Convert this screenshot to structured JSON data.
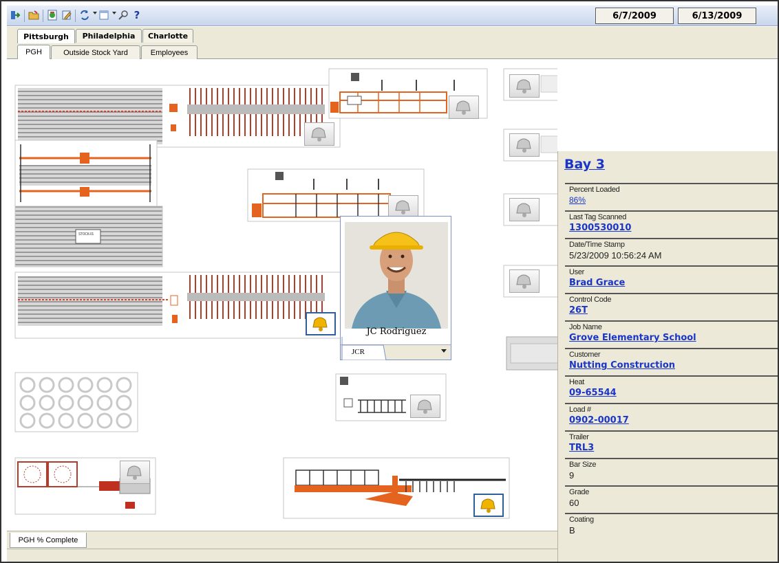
{
  "toolbar": {
    "icons": [
      "exit-icon",
      "open-folder-icon",
      "report-icon",
      "edit-icon",
      "refresh-icon",
      "view-icon",
      "search-icon",
      "help-icon"
    ],
    "help_glyph": "?",
    "start_date": "6/7/2009",
    "end_date": "6/13/2009"
  },
  "location_tabs": [
    "Pittsburgh",
    "Philadelphia",
    "Charlotte"
  ],
  "area_tabs": [
    "PGH",
    "Outside Stock Yard",
    "Employees"
  ],
  "canvas": {
    "stock_label": "STOCK-01"
  },
  "employee": {
    "name": "JC Rodriguez",
    "initials": "JCR"
  },
  "detail": {
    "title": "Bay 3",
    "fields": [
      {
        "label": "Percent Loaded",
        "value": "86%"
      },
      {
        "label": "Last Tag Scanned",
        "value": "1300530010"
      },
      {
        "label": "Date/Time Stamp",
        "value": "5/23/2009 10:56:24 AM"
      },
      {
        "label": "User",
        "value": "Brad Grace"
      },
      {
        "label": "Control Code",
        "value": "26T"
      },
      {
        "label": "Job Name",
        "value": "Grove Elementary School"
      },
      {
        "label": "Customer",
        "value": "Nutting Construction"
      },
      {
        "label": "Heat",
        "value": "09-65544"
      },
      {
        "label": "Load #",
        "value": "0902-00017"
      },
      {
        "label": "Trailer",
        "value": "TRL3"
      },
      {
        "label": "Bar Size",
        "value": "9"
      },
      {
        "label": "Grade",
        "value": "60"
      },
      {
        "label": "Coating",
        "value": "B"
      }
    ]
  },
  "bottom_tabs": [
    "PGH % Complete"
  ],
  "colors": {
    "link": "#1a35c9",
    "accent_orange": "#e4641f",
    "active_bell": "#f0b400",
    "panel_bg": "#ece9d8"
  }
}
